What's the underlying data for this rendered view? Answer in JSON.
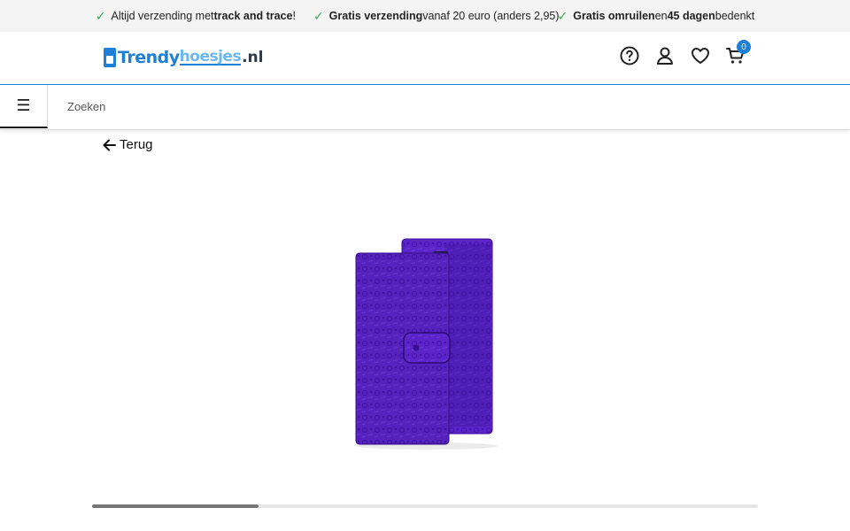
{
  "topbar": {
    "usp1": {
      "pre": "Altijd verzending met ",
      "bold": "track and trace",
      "post": "!"
    },
    "usp2": {
      "bold": "Gratis verzending",
      "post": " vanaf 20 euro (anders 2,95)"
    },
    "usp3": {
      "bold1": "Gratis omruilen",
      "mid": " en ",
      "bold2": "45 dagen",
      "post": " bedenkt"
    }
  },
  "header": {
    "logo": {
      "part1": "Trendy",
      "part2": "hoesjes",
      "part3": ".nl"
    },
    "cart_count": "0",
    "icons": [
      "help-icon",
      "account-icon",
      "heart-icon",
      "cart-icon"
    ]
  },
  "search": {
    "placeholder": "Zoeken",
    "menu_icon": "hamburger-icon"
  },
  "back": {
    "label": "Terug"
  },
  "gallery": {
    "progress_fraction": 0.25,
    "product_color": "#5a24c8"
  },
  "colors": {
    "accent": "#1d7fd6",
    "check": "#3aa85a"
  }
}
